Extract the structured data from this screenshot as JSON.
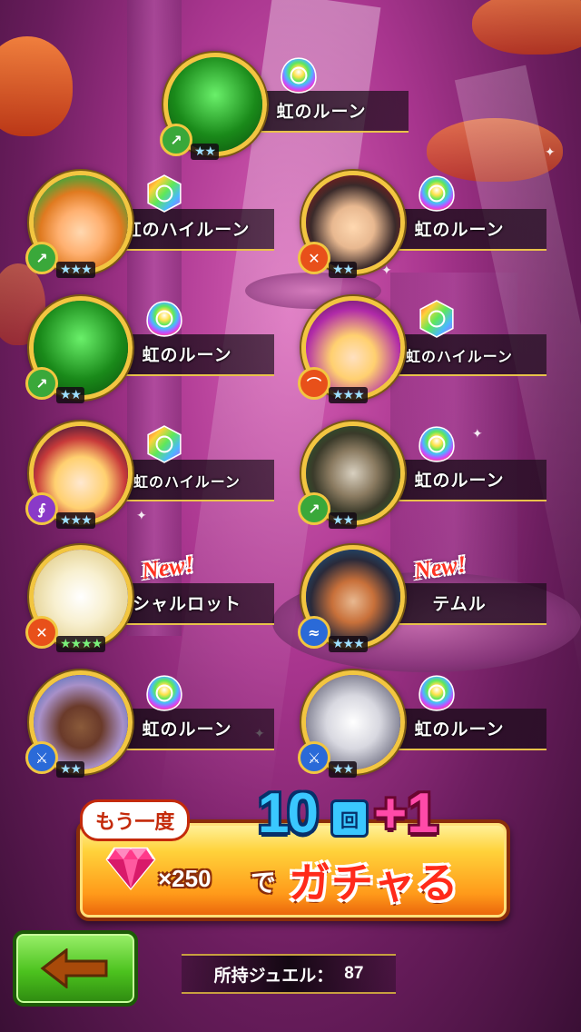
{
  "results": [
    {
      "name": "虹のルーン",
      "element": "wind",
      "stars": "★★",
      "type": "rune",
      "rune": "rune"
    },
    {
      "name": "虹のハイルーン",
      "element": "wind",
      "stars": "★★★",
      "type": "character-rune",
      "rune": "high-rune"
    },
    {
      "name": "虹のルーン",
      "element": "fire",
      "stars": "★★",
      "type": "character-rune",
      "rune": "rune"
    },
    {
      "name": "虹のルーン",
      "element": "wind",
      "stars": "★★",
      "type": "rune",
      "rune": "rune"
    },
    {
      "name": "虹のハイルーン",
      "element": "fire",
      "stars": "★★★",
      "type": "character-rune",
      "rune": "high-rune"
    },
    {
      "name": "虹のハイルーン",
      "element": "dark",
      "stars": "★★★",
      "type": "character-rune",
      "rune": "high-rune"
    },
    {
      "name": "虹のルーン",
      "element": "wind",
      "stars": "★★",
      "type": "character-rune",
      "rune": "rune"
    },
    {
      "name": "シャルロット",
      "element": "fire",
      "stars": "★★★★",
      "type": "new",
      "new_label": "New!"
    },
    {
      "name": "テムル",
      "element": "water",
      "stars": "★★★",
      "type": "new",
      "new_label": "New!"
    },
    {
      "name": "虹のルーン",
      "element": "water",
      "stars": "★★",
      "type": "character-rune",
      "rune": "rune"
    },
    {
      "name": "虹のルーン",
      "element": "water",
      "stars": "★★",
      "type": "character-rune",
      "rune": "rune"
    }
  ],
  "gacha": {
    "again_label": "もう一度",
    "count": "10",
    "kai": "回",
    "bonus": "+1",
    "cost": "×250",
    "de": "で",
    "action": "ガチャる"
  },
  "footer": {
    "jewel_label": "所持ジュエル：",
    "jewel_count": "87"
  },
  "colors": {
    "fire": "#e8501a",
    "wind": "#3aa83a",
    "water": "#2a6ad8",
    "dark": "#8a3ac8"
  }
}
